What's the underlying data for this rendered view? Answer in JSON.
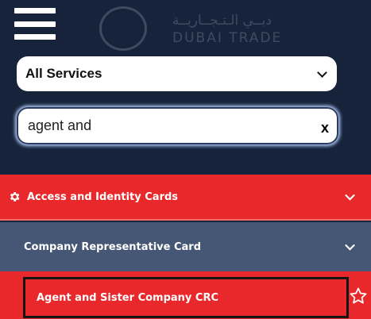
{
  "header": {
    "logo_arabic": "دبــي الـتـجــاريــة",
    "logo_english": "DUBAI TRADE"
  },
  "filter": {
    "selected_service": "All Services",
    "options": [
      "All Services"
    ]
  },
  "search": {
    "value": "agent and",
    "clear_label": "x"
  },
  "categories": [
    {
      "label": "Access and Identity Cards",
      "icon": "gear-icon",
      "subcategories": [
        {
          "label": "Company Representative Card",
          "items": [
            {
              "label": "Agent and Sister Company CRC",
              "icon": "star-icon"
            }
          ]
        }
      ]
    }
  ],
  "colors": {
    "header_bg": "#16233b",
    "accent_red": "#e8282b",
    "subcategory_bg": "#465775"
  }
}
